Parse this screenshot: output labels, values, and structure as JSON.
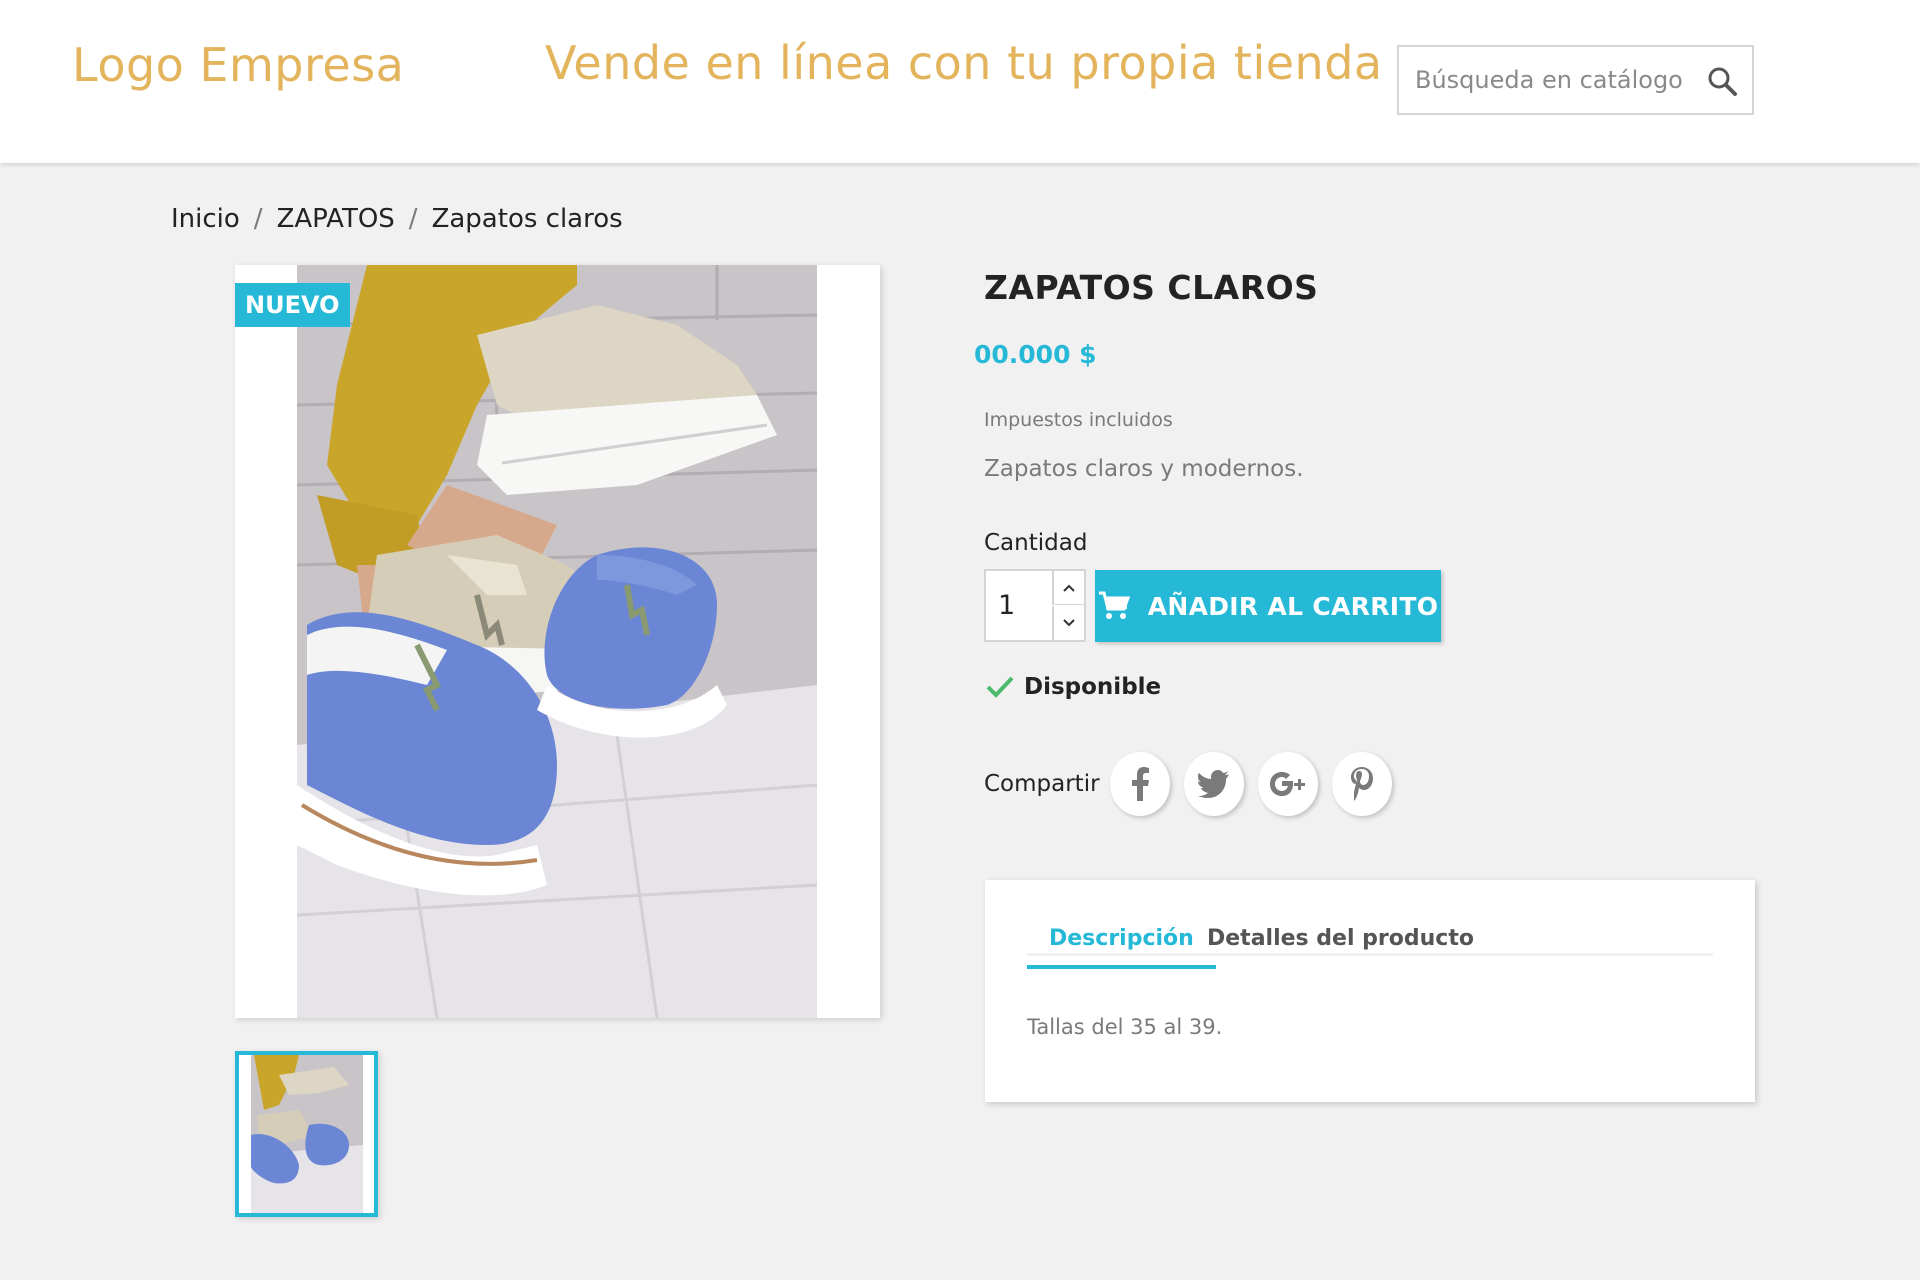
{
  "header": {
    "logo": "Logo Empresa",
    "tagline": "Vende en línea con tu propia tienda",
    "search_placeholder": "Búsqueda en catálogo"
  },
  "breadcrumb": {
    "items": [
      "Inicio",
      "ZAPATOS",
      "Zapatos claros"
    ],
    "separator": "/"
  },
  "product": {
    "badge": "NUEVO",
    "title": "ZAPATOS CLAROS",
    "price": "00.000 $",
    "tax_note": "Impuestos incluidos",
    "short_description": "Zapatos claros y modernos.",
    "quantity_label": "Cantidad",
    "quantity_value": "1",
    "add_to_cart": "AÑADIR AL CARRITO",
    "availability": "Disponible",
    "share_label": "Compartir",
    "social_icons": [
      "facebook-icon",
      "twitter-icon",
      "google-plus-icon",
      "pinterest-icon"
    ]
  },
  "tabs": {
    "items": [
      "Descripción",
      "Detalles del producto"
    ],
    "active": 0,
    "content": "Tallas del 35 al 39."
  },
  "colors": {
    "accent": "#25b9d7",
    "brand_gold": "#e3b45c",
    "background": "#f1f1f1",
    "check_green": "#4cbb6c"
  }
}
